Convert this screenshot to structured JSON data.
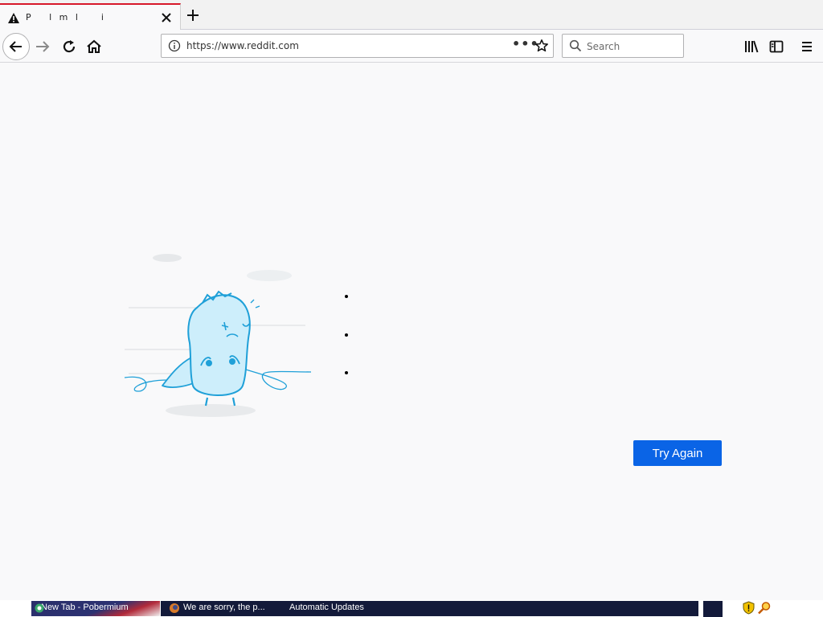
{
  "tab": {
    "title": "P   l m l    i",
    "warning_icon": "warning-icon",
    "close_icon": "close-icon"
  },
  "navbar": {
    "url": "https://www.reddit.com",
    "search_placeholder": "Search",
    "page_actions_label": "•••"
  },
  "content": {
    "illustration": "sad-dinosaur-unplugged-cable",
    "bullet_count": 3,
    "try_again_label": "Try Again"
  },
  "taskbar": {
    "items": [
      {
        "label": "New Tab - Pobermium"
      },
      {
        "label": "We are sorry, the p..."
      },
      {
        "label": "Automatic Updates"
      }
    ]
  },
  "colors": {
    "accent": "#0a64e6",
    "tab_highlight": "#d7182a",
    "taskbar": "#131a3a",
    "illustration_line": "#1fa0d8",
    "illustration_fill": "#cdeefb"
  }
}
